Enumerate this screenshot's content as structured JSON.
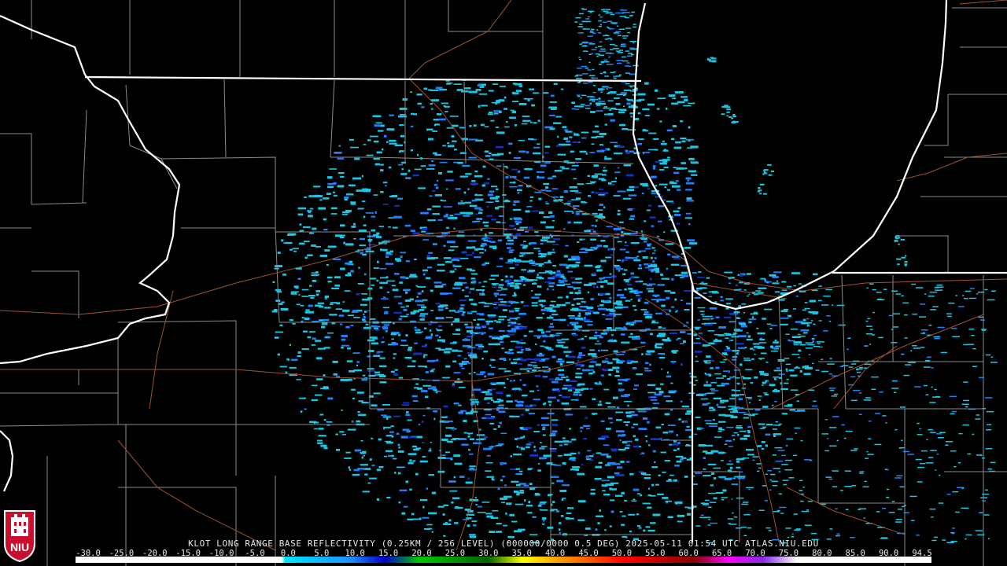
{
  "product": {
    "caption": "KLOT LONG RANGE BASE REFLECTIVITY (0.25KM / 256 LEVEL) (000000/0000 0.5 DEG) 2025-05-11 01:54 UTC  ATLAS.NIU.EDU"
  },
  "logo": {
    "text": "NIU",
    "color": "#c8102e"
  },
  "scale": {
    "labels": [
      "-30.0",
      "-25.0",
      "-20.0",
      "-15.0",
      "-10.0",
      "-5.0",
      "0.0",
      "5.0",
      "10.0",
      "15.0",
      "20.0",
      "25.0",
      "30.0",
      "35.0",
      "40.0",
      "45.0",
      "50.0",
      "55.0",
      "60.0",
      "65.0",
      "70.0",
      "75.0",
      "80.0",
      "85.0",
      "90.0",
      "94.5"
    ],
    "stops": [
      {
        "dbz": -30,
        "color": "#ffffff"
      },
      {
        "dbz": 0,
        "color": "#ffffff"
      },
      {
        "dbz": 0.5,
        "color": "#00e5ff"
      },
      {
        "dbz": 10,
        "color": "#1e90ff"
      },
      {
        "dbz": 15,
        "color": "#0000cd"
      },
      {
        "dbz": 20,
        "color": "#00c800"
      },
      {
        "dbz": 30,
        "color": "#006400"
      },
      {
        "dbz": 35,
        "color": "#ffff00"
      },
      {
        "dbz": 40,
        "color": "#ffa500"
      },
      {
        "dbz": 50,
        "color": "#ff0000"
      },
      {
        "dbz": 60,
        "color": "#8b0000"
      },
      {
        "dbz": 65,
        "color": "#ff00ff"
      },
      {
        "dbz": 70,
        "color": "#8a2be2"
      },
      {
        "dbz": 75,
        "color": "#ffffff"
      },
      {
        "dbz": 94.5,
        "color": "#ffffff"
      }
    ],
    "min": -30,
    "max": 94.5
  },
  "colors": {
    "background": "#000000",
    "state_border": "#ffffff",
    "county_border": "#8c8c8c",
    "highway": "#a0522d",
    "echo_light": "#19c8e6",
    "echo_mid": "#1e82ff",
    "echo_dark": "#1432c8"
  }
}
